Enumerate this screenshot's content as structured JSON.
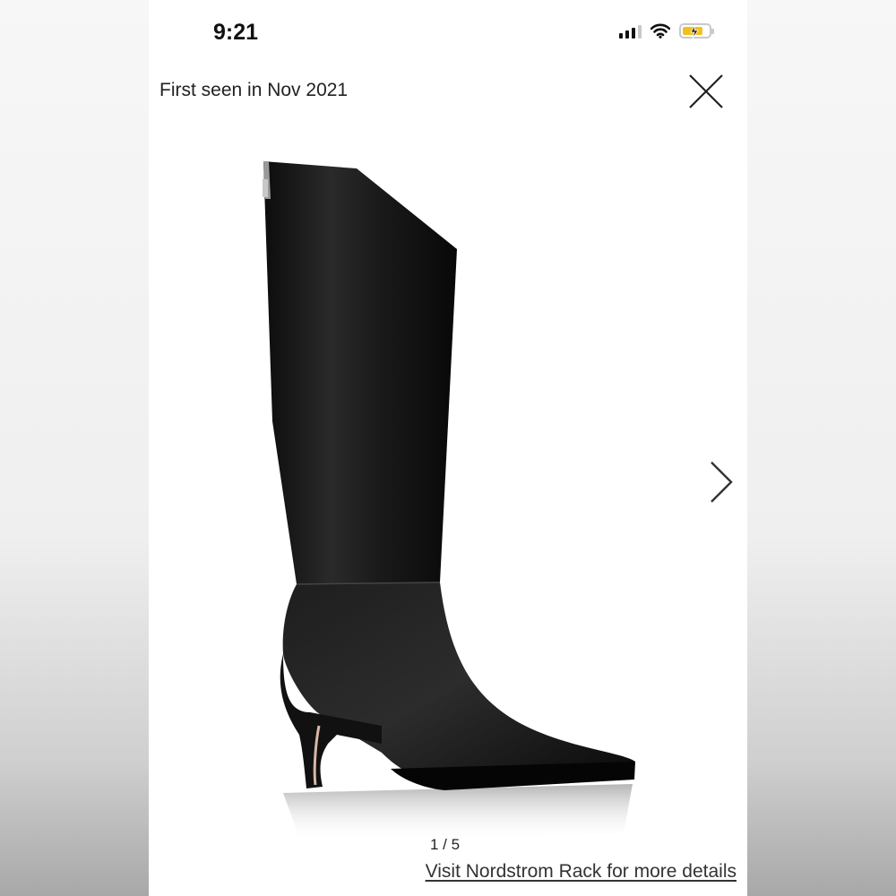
{
  "status_bar": {
    "time": "9:21",
    "icons": [
      "cellular-signal-icon",
      "wifi-icon",
      "battery-charging-icon"
    ],
    "battery_color": "#f2c01e"
  },
  "header": {
    "first_seen": "First seen in Nov 2021",
    "close_icon": "close-icon"
  },
  "gallery": {
    "image_alt": "Black leather knee-high boot",
    "pager": "1 / 5",
    "next_icon": "chevron-right-icon"
  },
  "footer": {
    "link": "Visit Nordstrom Rack for more details"
  }
}
